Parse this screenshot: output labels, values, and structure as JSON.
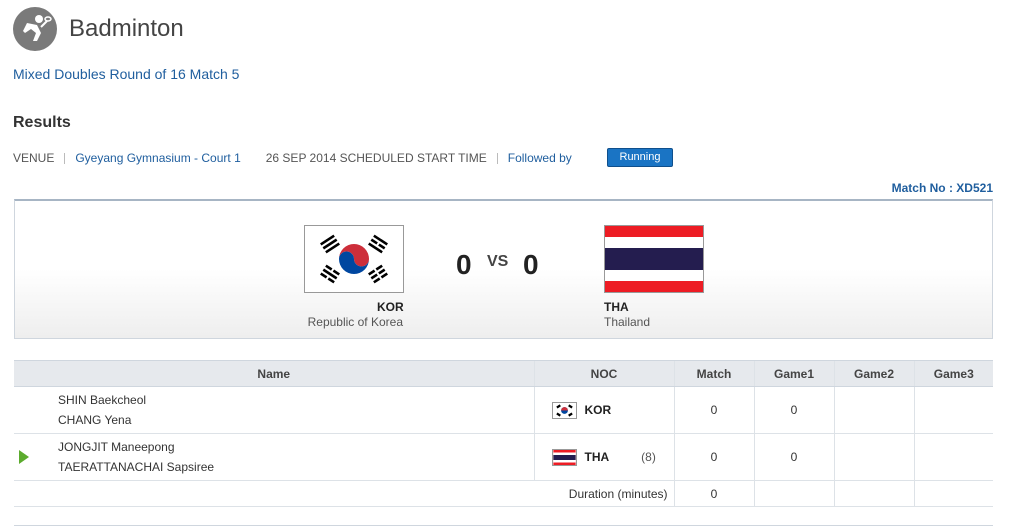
{
  "header": {
    "title": "Badminton",
    "icon": "badminton-player-icon"
  },
  "subtitle": "Mixed Doubles Round of 16 Match 5",
  "results_heading": "Results",
  "venue": {
    "label": "VENUE",
    "name": "Gyeyang Gymnasium - Court 1",
    "date_text": "26 SEP 2014 SCHEDULED START TIME",
    "followed": "Followed by",
    "status": "Running"
  },
  "match_no": "Match No : XD521",
  "scoreboard": {
    "home": {
      "code": "KOR",
      "name": "Republic of Korea",
      "score": "0"
    },
    "away": {
      "code": "THA",
      "name": "Thailand",
      "score": "0"
    },
    "vs": "VS"
  },
  "table": {
    "headers": [
      "Name",
      "NOC",
      "Match",
      "Game1",
      "Game2",
      "Game3"
    ],
    "rows": [
      {
        "players": [
          "SHIN Baekcheol",
          "CHANG Yena"
        ],
        "noc": "KOR",
        "seed": "",
        "match": "0",
        "game1": "0",
        "game2": "",
        "game3": "",
        "serving": false
      },
      {
        "players": [
          "JONGJIT Maneepong",
          "TAERATTANACHAI Sapsiree"
        ],
        "noc": "THA",
        "seed": "(8)",
        "match": "0",
        "game1": "0",
        "game2": "",
        "game3": "",
        "serving": true
      }
    ],
    "duration_label": "Duration (minutes)",
    "duration_value": "0"
  },
  "colors": {
    "link": "#1f5e9e",
    "status_button": "#1a74c4",
    "serving_indicator": "#5cab2e"
  }
}
